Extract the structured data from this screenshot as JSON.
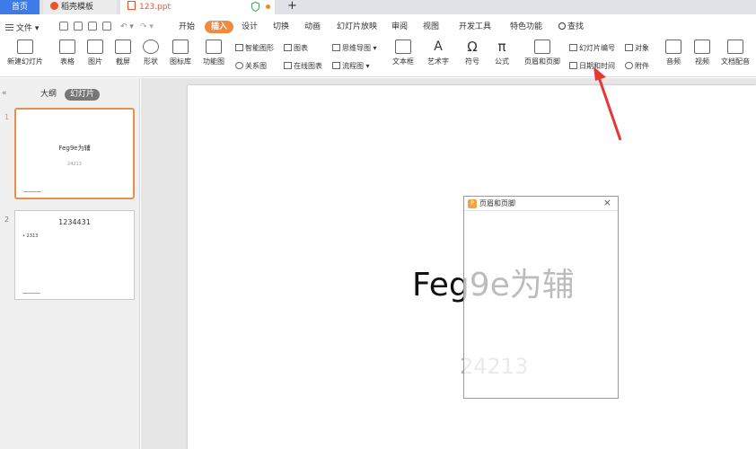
{
  "tabbar": {
    "home": "首页",
    "docer": "稻壳模板",
    "document": "123.ppt"
  },
  "menubar": {
    "file": "文件",
    "tabs": [
      "开始",
      "插入",
      "设计",
      "切换",
      "动画",
      "幻灯片放映",
      "审阅",
      "视图",
      "开发工具",
      "特色功能"
    ],
    "active_tab": "插入",
    "search": "查找"
  },
  "ribbon": {
    "new_slide": "新建幻灯片",
    "table": "表格",
    "picture": "图片",
    "screenshot": "截屏",
    "shape": "形状",
    "icon_library": "图标库",
    "function_chart": "功能图",
    "smart_graphic": "智能图形",
    "chart": "图表",
    "mind_map": "思维导图",
    "relation_chart": "关系图",
    "online_chart": "在线图表",
    "flowchart": "流程图",
    "textbox": "文本框",
    "wordart": "艺术字",
    "symbol": "符号",
    "formula": "公式",
    "header_footer": "页眉和页脚",
    "slide_number": "幻灯片编号",
    "object": "对象",
    "date_time": "日期和时间",
    "attachment": "附件",
    "audio": "音频",
    "video": "视频",
    "doc_dubbing": "文档配音"
  },
  "panel": {
    "outline": "大纲",
    "slides": "幻灯片"
  },
  "slides": [
    {
      "number": "1",
      "title": "Feg9e为辅",
      "sub": "24213"
    },
    {
      "number": "2",
      "title": "1234431",
      "bullet": "• 2313"
    }
  ],
  "canvas": {
    "title": "Feg9e为辅",
    "subtitle": "24213"
  },
  "dialog": {
    "title": "页眉和页脚",
    "icon_text": "P",
    "close": "×"
  },
  "colors": {
    "accent": "#f18a3c",
    "home_tab": "#3d7be8",
    "arrow": "#e53935"
  }
}
